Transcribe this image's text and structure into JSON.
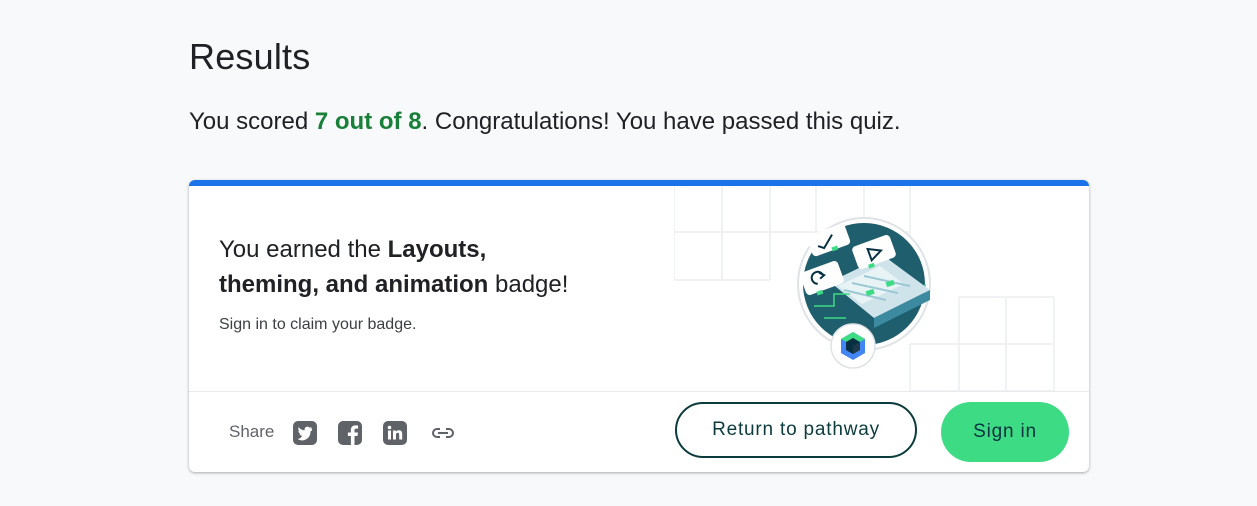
{
  "page": {
    "title": "Results",
    "score_prefix": "You scored ",
    "score_value": "7 out of 8",
    "score_suffix": ". Congratulations! You have passed this quiz."
  },
  "badge_card": {
    "heading_prefix": "You earned the ",
    "badge_name_line1": "Layouts,",
    "badge_name_line2": "theming, and animation",
    "heading_suffix": " badge!",
    "signin_hint": "Sign in to claim your badge.",
    "illustration_icon": "jetpack-compose-badge-icon"
  },
  "footer": {
    "share_label": "Share",
    "share_icons": [
      "twitter-icon",
      "facebook-icon",
      "linkedin-icon",
      "link-icon"
    ],
    "return_button_label": "Return to pathway",
    "signin_button_label": "Sign in"
  },
  "colors": {
    "accent_blue": "#1a73e8",
    "score_green": "#188038",
    "signin_green": "#3ddc84",
    "dark_teal": "#0b3b3c",
    "page_background": "#f8f9fa"
  }
}
